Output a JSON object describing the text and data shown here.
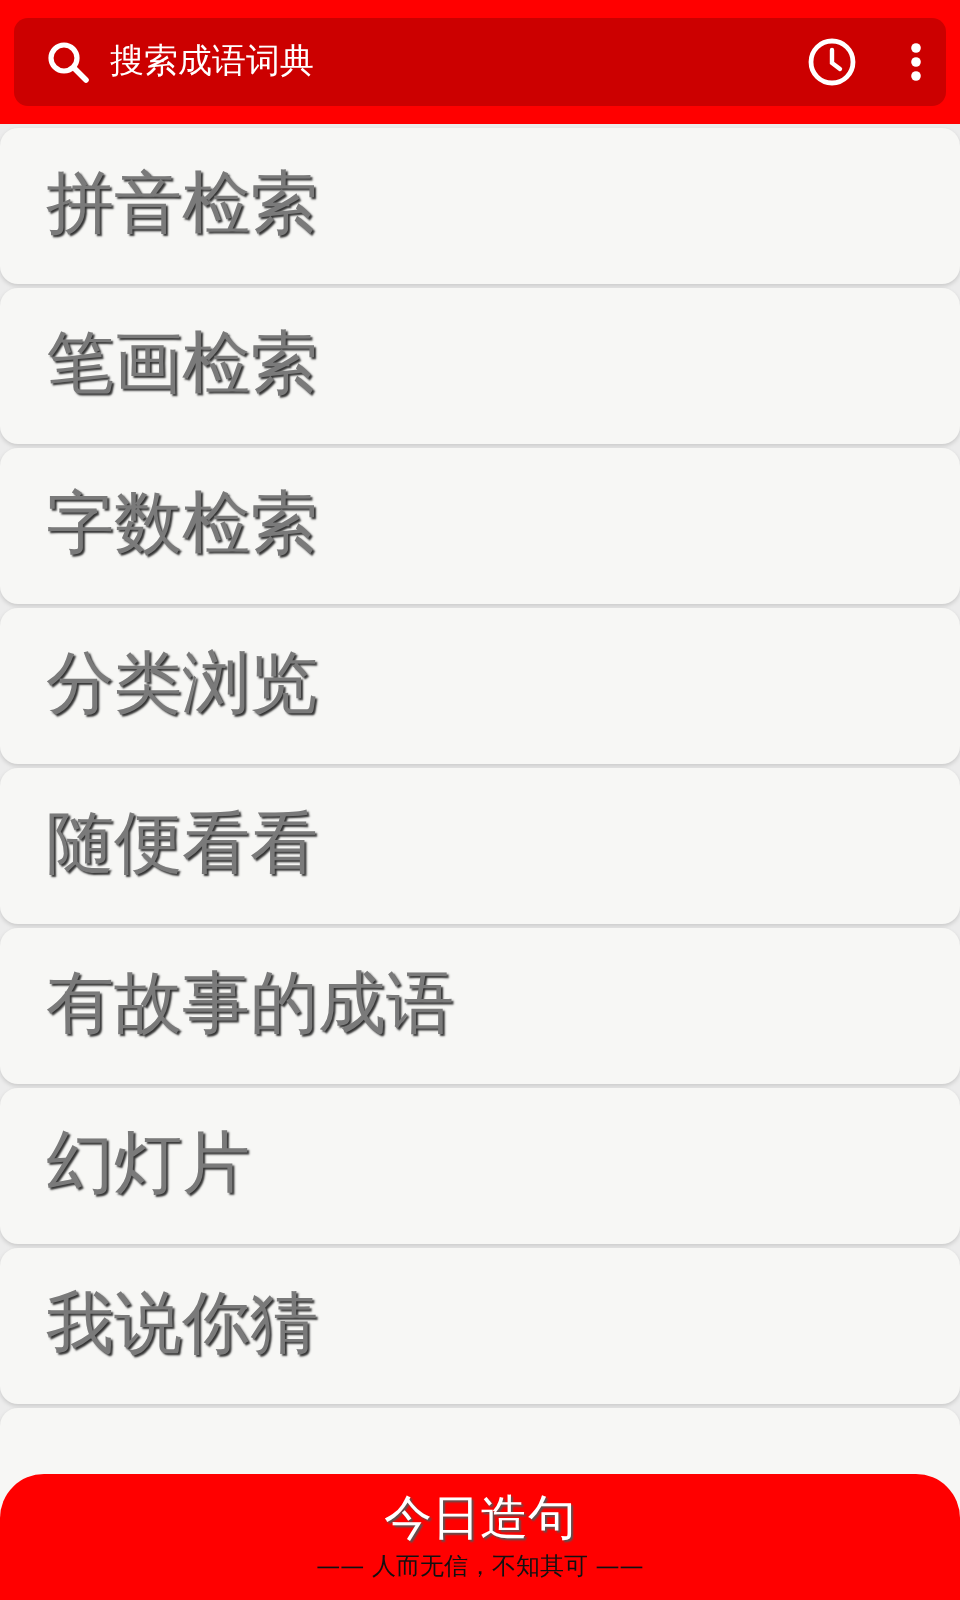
{
  "search": {
    "placeholder": "搜索成语词典"
  },
  "menu_items": [
    {
      "label": "拼音检索"
    },
    {
      "label": "笔画检索"
    },
    {
      "label": "字数检索"
    },
    {
      "label": "分类浏览"
    },
    {
      "label": "随便看看"
    },
    {
      "label": "有故事的成语"
    },
    {
      "label": "幻灯片"
    },
    {
      "label": "我说你猜"
    }
  ],
  "daily_sentence": {
    "title": "今日造句",
    "idiom": "—— 人而无信，不知其可 ——"
  }
}
